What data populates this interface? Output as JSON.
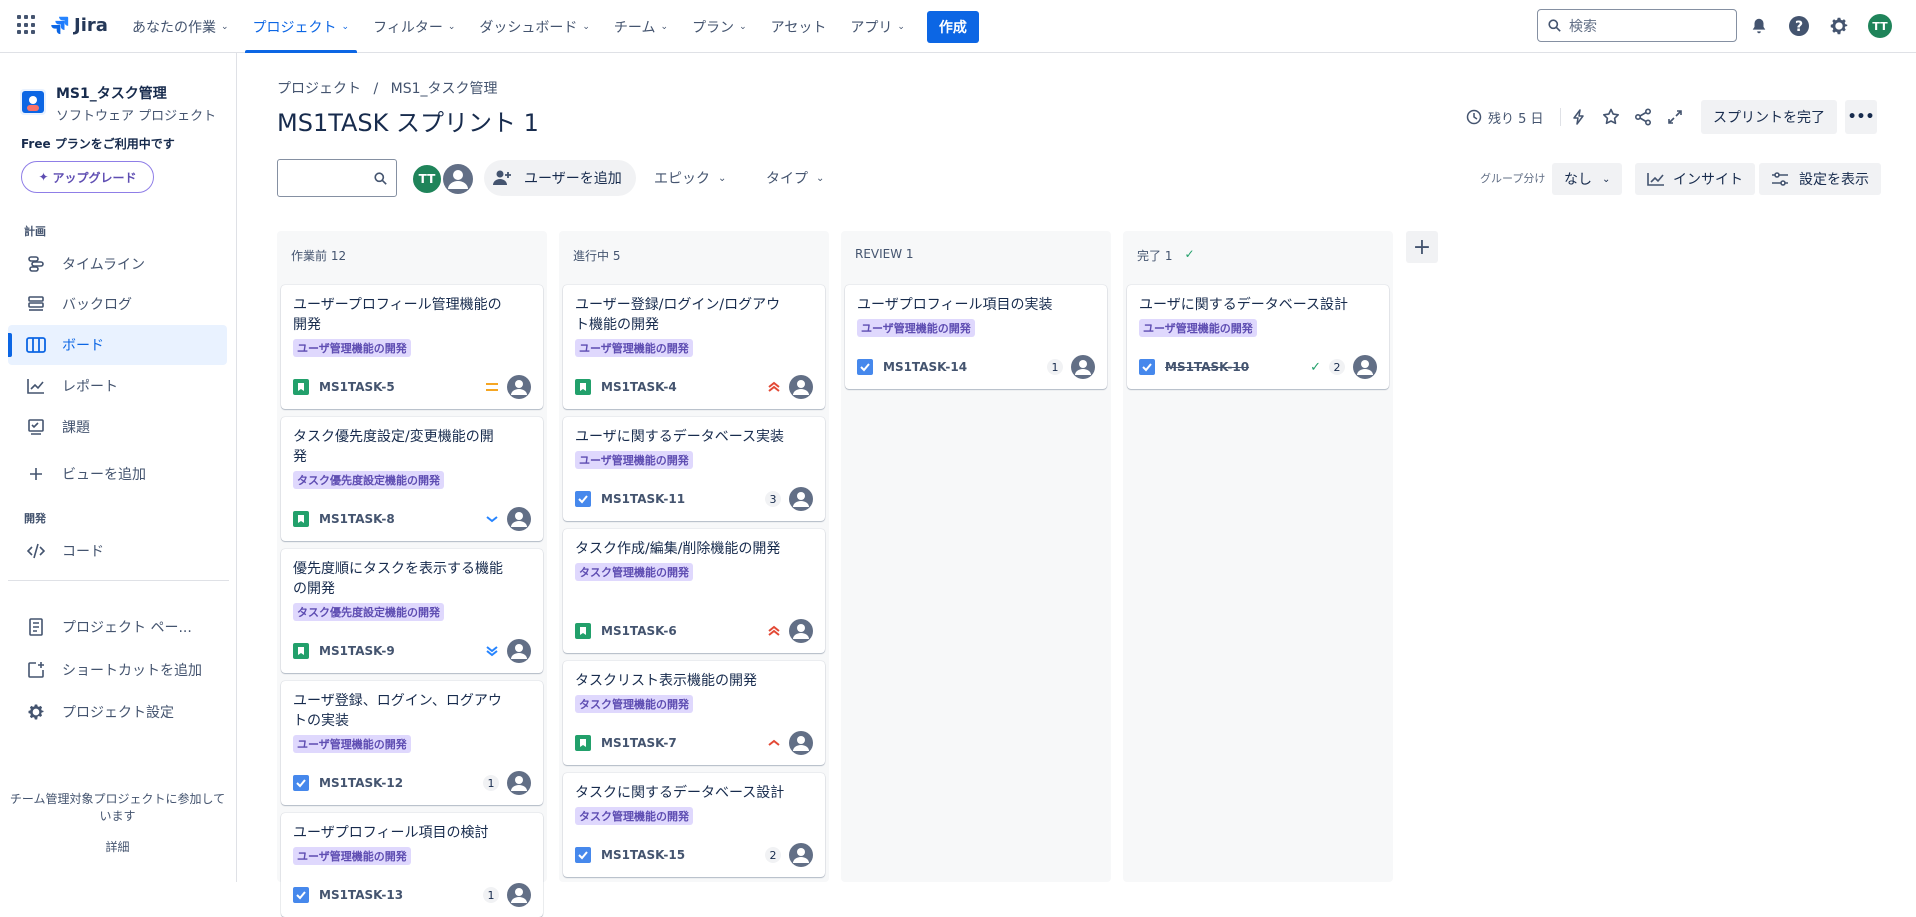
{
  "top": {
    "logo_text": "Jira",
    "nav": [
      {
        "label": "あなたの作業",
        "chevron": true,
        "active": false
      },
      {
        "label": "プロジェクト",
        "chevron": true,
        "active": true
      },
      {
        "label": "フィルター",
        "chevron": true,
        "active": false
      },
      {
        "label": "ダッシュボード",
        "chevron": true,
        "active": false
      },
      {
        "label": "チーム",
        "chevron": true,
        "active": false
      },
      {
        "label": "プラン",
        "chevron": true,
        "active": false
      },
      {
        "label": "アセット",
        "chevron": false,
        "active": false
      },
      {
        "label": "アプリ",
        "chevron": true,
        "active": false
      }
    ],
    "create_label": "作成",
    "search_placeholder": "検索",
    "user_initials": "TT"
  },
  "sidebar": {
    "project_name": "MS1_タスク管理",
    "project_type": "ソフトウェア プロジェクト",
    "free_plan": "Free プランをご利用中です",
    "upgrade": "アップグレード",
    "section_plan": "計画",
    "section_dev": "開発",
    "items": [
      {
        "label": "タイムライン",
        "icon": "timeline-icon"
      },
      {
        "label": "バックログ",
        "icon": "backlog-icon"
      },
      {
        "label": "ボード",
        "icon": "board-icon",
        "active": true
      },
      {
        "label": "レポート",
        "icon": "reports-icon"
      },
      {
        "label": "課題",
        "icon": "issues-icon"
      },
      {
        "label": "ビューを追加",
        "icon": "plus-icon"
      },
      {
        "label": "コード",
        "icon": "code-icon"
      },
      {
        "label": "プロジェクト ペー...",
        "icon": "page-icon"
      },
      {
        "label": "ショートカットを追加",
        "icon": "shortcut-icon"
      },
      {
        "label": "プロジェクト設定",
        "icon": "gear-icon"
      }
    ],
    "team_text": "チーム管理対象プロジェクトに参加しています",
    "details": "詳細"
  },
  "header": {
    "breadcrumb_root": "プロジェクト",
    "breadcrumb_sep": "/",
    "breadcrumb_project": "MS1_タスク管理",
    "title": "MS1TASK スプリント 1",
    "remaining": "残り 5 日",
    "complete_sprint": "スプリントを完了"
  },
  "filters": {
    "avatar_initials": "TT",
    "add_user": "ユーザーを追加",
    "epic": "エピック",
    "type": "タイプ",
    "group_by_label": "グループ分け",
    "group_by_value": "なし",
    "insights": "インサイト",
    "view_settings": "設定を表示"
  },
  "colors": {
    "accent": "#0c66e4",
    "epic_bg": "#dfd8fd",
    "epic_fg": "#5e4db2",
    "story": "#22a06b",
    "task": "#4688ec"
  },
  "columns": [
    {
      "name": "作業前 12",
      "done_check": false,
      "cards": [
        {
          "title": "ユーザープロフィール管理機能の開発",
          "epic": "ユーザ管理機能の開発",
          "type": "story",
          "key": "MS1TASK-5",
          "priority": "medium",
          "count": ""
        },
        {
          "title": "タスク優先度設定/変更機能の開発",
          "epic": "タスク優先度設定機能の開発",
          "type": "story",
          "key": "MS1TASK-8",
          "priority": "low",
          "count": ""
        },
        {
          "title": "優先度順にタスクを表示する機能の開発",
          "epic": "タスク優先度設定機能の開発",
          "type": "story",
          "key": "MS1TASK-9",
          "priority": "lowest",
          "count": ""
        },
        {
          "title": "ユーザ登録、ログイン、ログアウトの実装",
          "epic": "ユーザ管理機能の開発",
          "type": "task",
          "key": "MS1TASK-12",
          "priority": "",
          "count": "1"
        },
        {
          "title": "ユーザプロフィール項目の検討",
          "epic": "ユーザ管理機能の開発",
          "type": "task",
          "key": "MS1TASK-13",
          "priority": "",
          "count": "1"
        }
      ]
    },
    {
      "name": "進行中 5",
      "done_check": false,
      "cards": [
        {
          "title": "ユーザー登録/ログイン/ログアウト機能の開発",
          "epic": "ユーザ管理機能の開発",
          "type": "story",
          "key": "MS1TASK-4",
          "priority": "highest",
          "count": ""
        },
        {
          "title": "ユーザに関するデータベース実装",
          "epic": "ユーザ管理機能の開発",
          "type": "task",
          "key": "MS1TASK-11",
          "priority": "",
          "count": "3"
        },
        {
          "title": "タスク作成/編集/削除機能の開発",
          "epic": "タスク管理機能の開発",
          "type": "story",
          "key": "MS1TASK-6",
          "priority": "highest",
          "count": ""
        },
        {
          "title": "タスクリスト表示機能の開発",
          "epic": "タスク管理機能の開発",
          "type": "story",
          "key": "MS1TASK-7",
          "priority": "high",
          "count": ""
        },
        {
          "title": "タスクに関するデータベース設計",
          "epic": "タスク管理機能の開発",
          "type": "task",
          "key": "MS1TASK-15",
          "priority": "",
          "count": "2"
        }
      ]
    },
    {
      "name": "REVIEW 1",
      "done_check": false,
      "cards": [
        {
          "title": "ユーザプロフィール項目の実装",
          "epic": "ユーザ管理機能の開発",
          "type": "task",
          "key": "MS1TASK-14",
          "priority": "",
          "count": "1"
        }
      ]
    },
    {
      "name": "完了 1",
      "done_check": true,
      "cards": [
        {
          "title": "ユーザに関するデータベース設計",
          "epic": "ユーザ管理機能の開発",
          "type": "task",
          "key": "MS1TASK-10",
          "priority": "",
          "count": "2",
          "done": true
        }
      ]
    }
  ]
}
